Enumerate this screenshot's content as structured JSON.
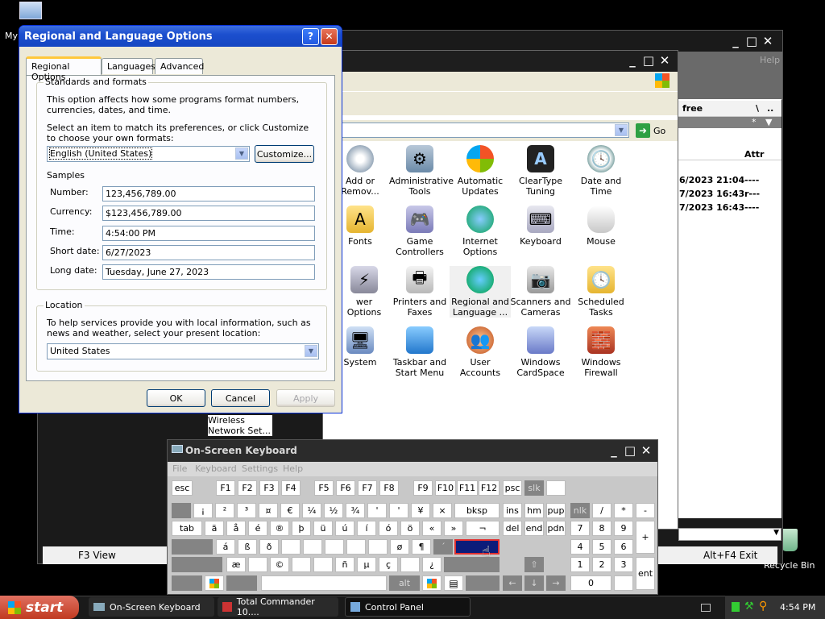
{
  "desktop": {
    "my_computer_label": "My",
    "recycle_bin_label": "Recycle Bin"
  },
  "total_commander": {
    "title_buttons": [
      "_",
      "□",
      "✕"
    ],
    "help_label": "Help",
    "free_label": "free",
    "backslash": "\\",
    "dotdot": "..",
    "star": "*",
    "attr_header": "Attr",
    "rows": [
      {
        "date": "6/2023 21:04",
        "attr": "----"
      },
      {
        "date": "7/2023 16:43",
        "attr": "r---"
      },
      {
        "date": "7/2023 16:43",
        "attr": "----"
      }
    ],
    "f3_label": "F3 View",
    "altf4_label": "Alt+F4 Exit"
  },
  "control_panel": {
    "go_label": "Go",
    "items": [
      {
        "label": "Add or Remov...",
        "icon": "add-remove-icon"
      },
      {
        "label": "Administrative Tools",
        "icon": "admin-tools-icon"
      },
      {
        "label": "Automatic Updates",
        "icon": "windows-logo-icon"
      },
      {
        "label": "ClearType Tuning",
        "icon": "cleartype-icon"
      },
      {
        "label": "Date and Time",
        "icon": "clock-icon"
      },
      {
        "label": "Fonts",
        "icon": "fonts-folder-icon"
      },
      {
        "label": "Game Controllers",
        "icon": "gamepad-icon"
      },
      {
        "label": "Internet Options",
        "icon": "globe-icon"
      },
      {
        "label": "Keyboard",
        "icon": "keyboard-icon"
      },
      {
        "label": "Mouse",
        "icon": "mouse-icon"
      },
      {
        "label": "wer Options",
        "icon": "power-icon"
      },
      {
        "label": "Printers and Faxes",
        "icon": "printer-icon"
      },
      {
        "label": "Regional and Language ...",
        "icon": "regional-globe-icon"
      },
      {
        "label": "Scanners and Cameras",
        "icon": "scanner-icon"
      },
      {
        "label": "Scheduled Tasks",
        "icon": "scheduled-tasks-icon"
      },
      {
        "label": "System",
        "icon": "system-icon"
      },
      {
        "label": "Taskbar and Start Menu",
        "icon": "taskbar-icon"
      },
      {
        "label": "User Accounts",
        "icon": "users-icon"
      },
      {
        "label": "Windows CardSpace",
        "icon": "cardspace-icon"
      },
      {
        "label": "Windows Firewall",
        "icon": "firewall-icon"
      },
      {
        "label": "Wireless Network Set...",
        "icon": "wireless-icon"
      }
    ]
  },
  "dialog": {
    "title": "Regional and Language Options",
    "help_btn": "?",
    "close_btn": "✕",
    "tabs": [
      "Regional Options",
      "Languages",
      "Advanced"
    ],
    "standards_group": "Standards and formats",
    "standards_desc": "This option affects how some programs format numbers, currencies, dates, and time.",
    "select_desc": "Select an item to match its preferences, or click Customize to choose your own formats:",
    "format_value": "English (United States)",
    "customize_label": "Customize...",
    "samples_label": "Samples",
    "samples": [
      {
        "label": "Number:",
        "value": "123,456,789.00"
      },
      {
        "label": "Currency:",
        "value": "$123,456,789.00"
      },
      {
        "label": "Time:",
        "value": "4:54:00 PM"
      },
      {
        "label": "Short date:",
        "value": "6/27/2023"
      },
      {
        "label": "Long date:",
        "value": "Tuesday, June 27, 2023"
      }
    ],
    "location_group": "Location",
    "location_desc": "To help services provide you with local information, such as news and weather, select your present location:",
    "location_value": "United States",
    "ok_label": "OK",
    "cancel_label": "Cancel",
    "apply_label": "Apply"
  },
  "osk": {
    "title": "On-Screen Keyboard",
    "menu": [
      "File",
      "Keyboard",
      "Settings",
      "Help"
    ],
    "row1": [
      "esc",
      "F1",
      "F2",
      "F3",
      "F4",
      "F5",
      "F6",
      "F7",
      "F8",
      "F9",
      "F10",
      "F11",
      "F12",
      "psc",
      "slk"
    ],
    "row2": [
      "¡",
      "²",
      "³",
      "¤",
      "€",
      "¼",
      "½",
      "¾",
      "'",
      "'",
      "¥",
      "×",
      "bksp",
      "ins",
      "hm",
      "pup",
      "nlk",
      "/",
      "*",
      "-"
    ],
    "row3": [
      "tab",
      "ä",
      "å",
      "é",
      "®",
      "þ",
      "ü",
      "ú",
      "í",
      "ó",
      "ö",
      "«",
      "»",
      "¬",
      "del",
      "end",
      "pdn",
      "7",
      "8",
      "9",
      "+"
    ],
    "row4": [
      "á",
      "ß",
      "ð",
      "ø",
      "¶",
      "´",
      "4",
      "5",
      "6"
    ],
    "row5": [
      "æ",
      "©",
      "ñ",
      "µ",
      "ç",
      "¿",
      "1",
      "2",
      "3"
    ],
    "row6": [
      "alt",
      "0",
      "ent"
    ]
  },
  "taskbar": {
    "start_label": "start",
    "tasks": [
      "On-Screen Keyboard",
      "Total Commander 10....",
      "Control Panel"
    ],
    "clock": "4:54 PM"
  }
}
